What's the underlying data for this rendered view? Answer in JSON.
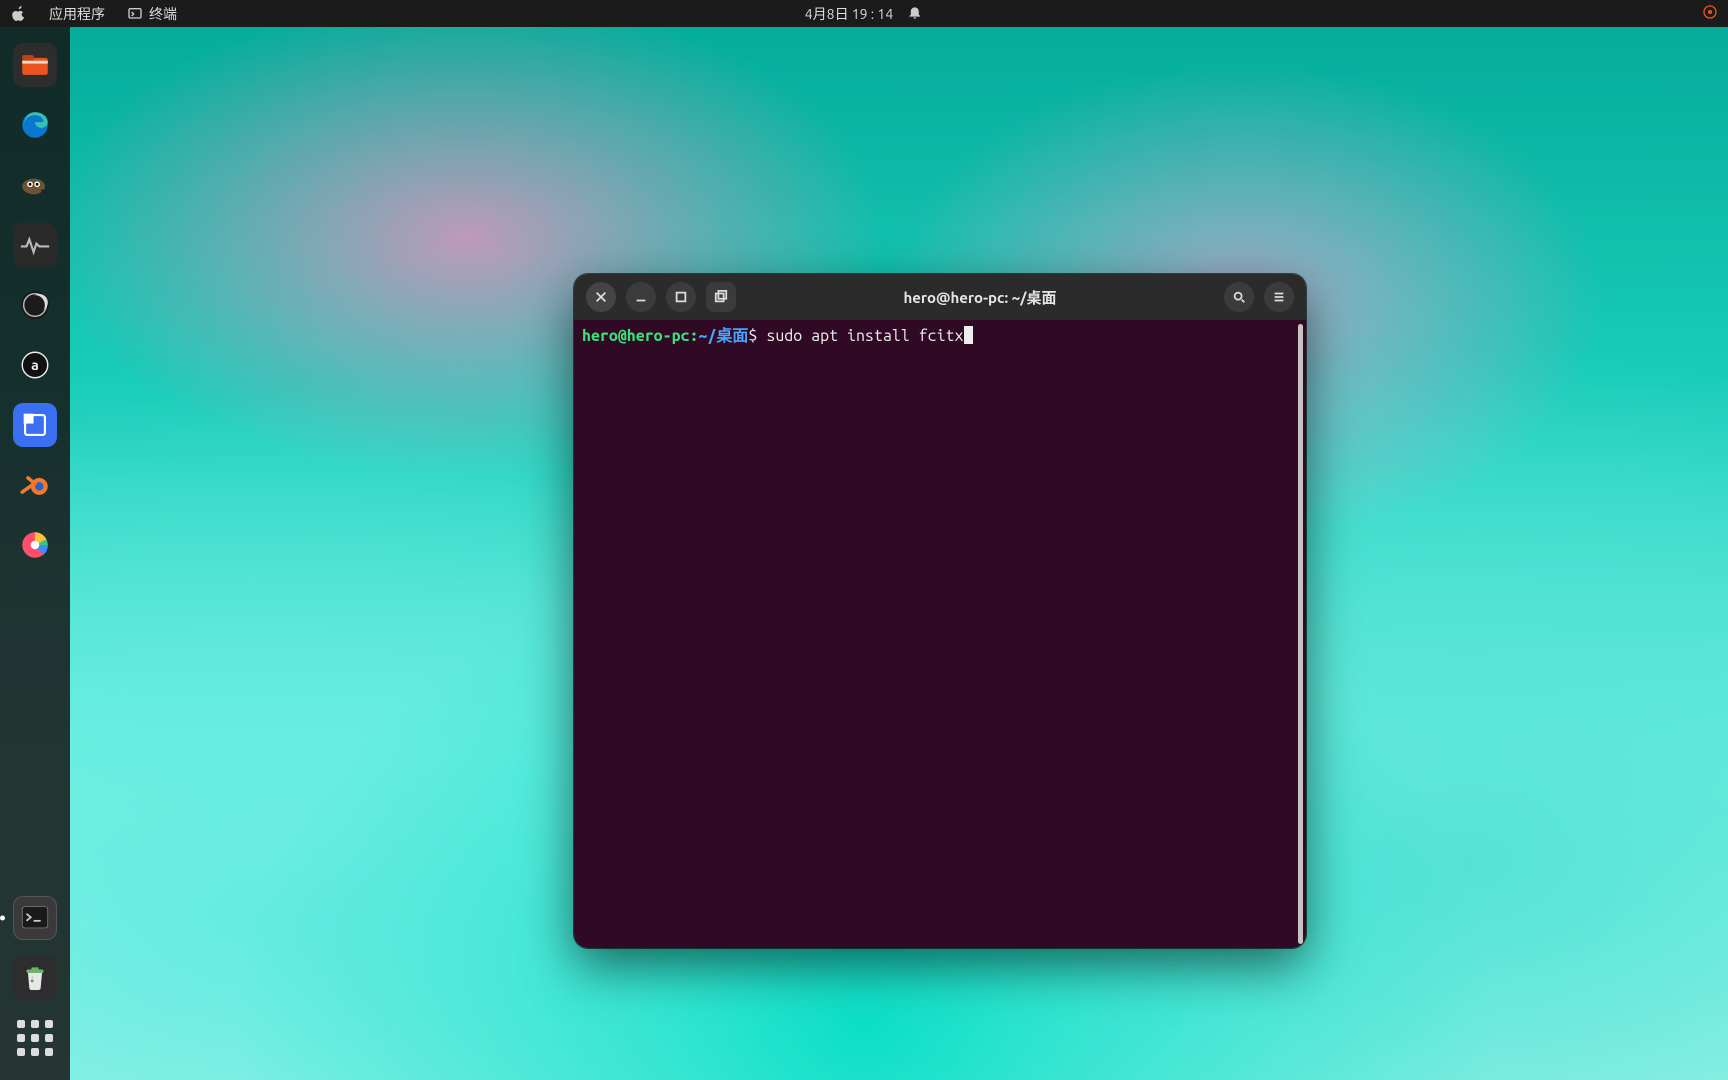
{
  "top_panel": {
    "apps_label": "应用程序",
    "active_app_label": "终端",
    "clock": "4月8日  19 : 14"
  },
  "dock": {
    "items": [
      {
        "name": "files",
        "title": "文件",
        "color": "#e95420"
      },
      {
        "name": "edge",
        "title": "Microsoft Edge",
        "color": "#0b78d0"
      },
      {
        "name": "gimp",
        "title": "GIMP",
        "color": "#6b5434"
      },
      {
        "name": "system-monitor",
        "title": "系统监视器",
        "color": "#2d2d2d"
      },
      {
        "name": "obs",
        "title": "OBS Studio",
        "color": "#1b1b1b"
      },
      {
        "name": "app-a",
        "title": "App",
        "color": "#111"
      },
      {
        "name": "screenshot",
        "title": "截图",
        "color": "#3a6ff1"
      },
      {
        "name": "blender",
        "title": "Blender",
        "color": "#f5792a"
      },
      {
        "name": "disk-usage",
        "title": "磁盘使用分析器",
        "color": "#ff4f6d"
      },
      {
        "name": "terminal",
        "title": "终端",
        "color": "#2d2d2d",
        "running": true,
        "active": true
      },
      {
        "name": "trash",
        "title": "回收站",
        "color": "#2f6e35"
      }
    ]
  },
  "terminal": {
    "title": "hero@hero-pc: ~/桌面",
    "prompt_user_host": "hero@hero-pc",
    "prompt_colon": ":",
    "prompt_path": "~/桌面",
    "prompt_symbol": "$",
    "command": "sudo apt install fcitx"
  }
}
